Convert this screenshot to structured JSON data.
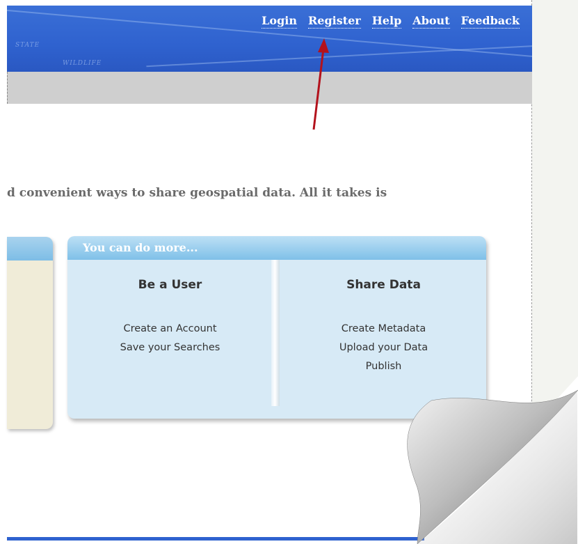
{
  "header": {
    "nav": [
      "Login",
      "Register",
      "Help",
      "About",
      "Feedback"
    ],
    "map_text_1": "STATE",
    "map_text_2": "WILDLIFE"
  },
  "intro_text": "d convenient ways to share geospatial data. All it takes is",
  "more_panel": {
    "title": "You can do more...",
    "columns": [
      {
        "heading": "Be a User",
        "links": [
          "Create an Account",
          "Save your Searches"
        ]
      },
      {
        "heading": "Share Data",
        "links": [
          "Create Metadata",
          "Upload your Data",
          "Publish"
        ]
      }
    ]
  },
  "colors": {
    "header_blue": "#2f62cf",
    "arrow_red": "#b3121c",
    "panel_blue": "#d7eaf6"
  }
}
